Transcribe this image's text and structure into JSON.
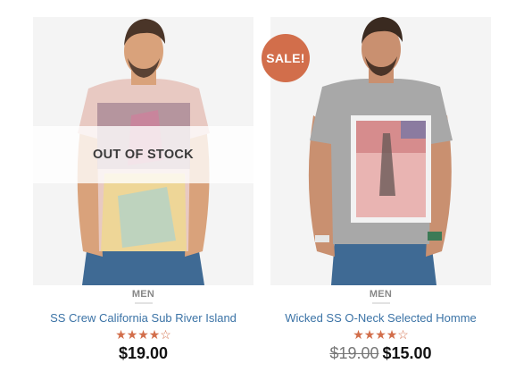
{
  "products": [
    {
      "category": "MEN",
      "title": "SS Crew California Sub River Island",
      "rating": 4,
      "max_rating": 5,
      "price": "$19.00",
      "overlay": "OUT OF STOCK"
    },
    {
      "category": "MEN",
      "title": "Wicked SS O-Neck Selected Homme",
      "rating": 4,
      "max_rating": 5,
      "old_price": "$19.00",
      "price": "$15.00",
      "badge": "SALE!"
    }
  ],
  "colors": {
    "accent": "#d26e4b",
    "link": "#3b73a6"
  }
}
